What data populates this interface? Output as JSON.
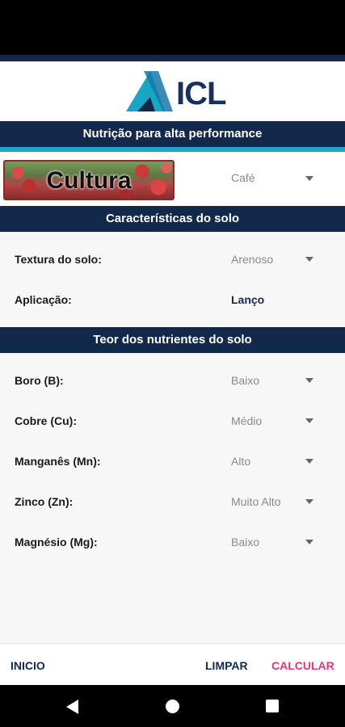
{
  "logo": {
    "text": "ICL"
  },
  "header_nutrition": "Nutrição para alta performance",
  "culture": {
    "image_label": "Cultura",
    "value": "Café"
  },
  "soil": {
    "header": "Características do solo",
    "texture_label": "Textura do solo:",
    "texture_value": "Arenoso",
    "application_label": "Aplicação:",
    "application_value": "Lanço"
  },
  "nutrients": {
    "header": "Teor dos nutrientes do solo",
    "items": [
      {
        "label": "Boro (B):",
        "value": "Baixo"
      },
      {
        "label": "Cobre (Cu):",
        "value": "Médio"
      },
      {
        "label": "Manganês (Mn):",
        "value": "Alto"
      },
      {
        "label": "Zinco (Zn):",
        "value": "Muito Alto"
      },
      {
        "label": "Magnésio (Mg):",
        "value": "Baixo"
      }
    ]
  },
  "bottom": {
    "inicio": "INICIO",
    "limpar": "LIMPAR",
    "calcular": "CALCULAR"
  },
  "colors": {
    "primary": "#13294b",
    "accent": "#1fa7c9",
    "calcular": "#e6337a"
  },
  "nav": {
    "back_icon": "back-triangle-icon",
    "home_icon": "home-circle-icon",
    "recent_icon": "recent-square-icon"
  }
}
